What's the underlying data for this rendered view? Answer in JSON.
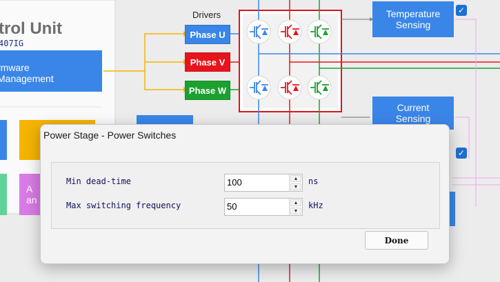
{
  "background": {
    "control_unit_title": "trol Unit",
    "control_unit_subtitle": "407IG",
    "firmware_block": "rmware\nManagement",
    "drivers_label": "Drivers",
    "phases": [
      {
        "label": "Phase U",
        "color": "#3a86e8"
      },
      {
        "label": "Phase V",
        "color": "#e8141c"
      },
      {
        "label": "Phase W",
        "color": "#1aa12f"
      }
    ],
    "temperature_block": "Temperature\nSensing",
    "current_block": "Current\nSensing",
    "partial_block": "A\nan",
    "checkbox_icon": "check-icon",
    "colors": {
      "blue": "#3a86e8",
      "red": "#e8141c",
      "green": "#1aa12f",
      "orange": "#f5b400",
      "pink": "#f0a6f0",
      "teal": "#5fd39a",
      "purple": "#d97be6"
    }
  },
  "dialog": {
    "title": "Power Stage - Power Switches",
    "fields": [
      {
        "label": "Min dead-time",
        "value": "100",
        "unit": "ns"
      },
      {
        "label": "Max switching frequency",
        "value": "50",
        "unit": "kHz"
      }
    ],
    "done_label": "Done"
  }
}
